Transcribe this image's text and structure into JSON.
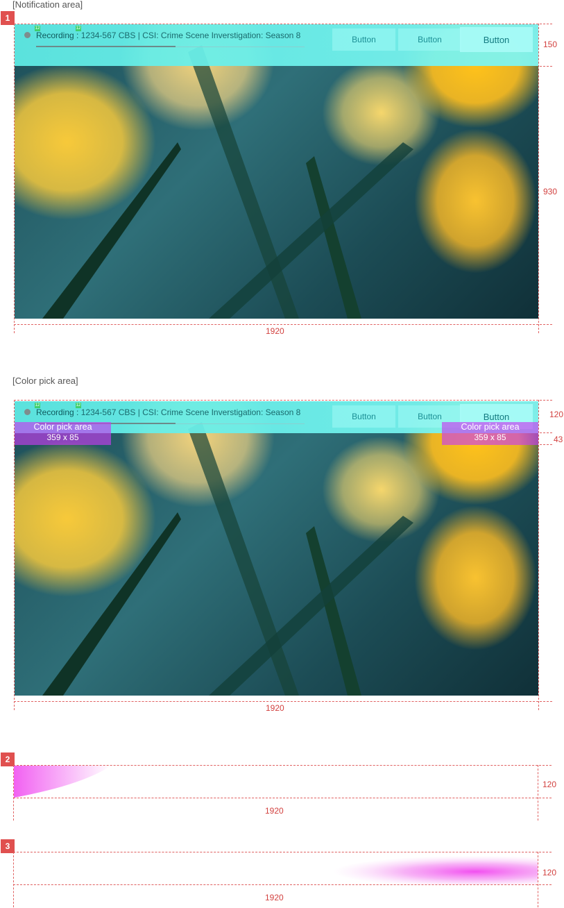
{
  "sections": {
    "notification": {
      "label": "[Notification area]",
      "badge": "1"
    },
    "color_pick": {
      "label": "[Color pick area]"
    },
    "strip2": {
      "badge": "2"
    },
    "strip3": {
      "badge": "3"
    }
  },
  "recording": {
    "prefix": "Recording :",
    "text": "1234-567 CBS | CSI: Crime Scene Inverstigation: Season 8",
    "progress": 0.52
  },
  "buttons": [
    "Button",
    "Button",
    "Button"
  ],
  "mini_tags": [
    "12",
    "12"
  ],
  "dimensions": {
    "notif_height": "150",
    "image_height": "930",
    "width": "1920",
    "bar_height": "120",
    "pick_offset": "43",
    "strip_height": "120"
  },
  "pick_area": {
    "title": "Color pick area",
    "size": "359 x 85"
  },
  "colors": {
    "accent": "#60EEE8",
    "marker": "#D2413F",
    "pick": "#C83CF0",
    "gradient": "#F050F0"
  }
}
